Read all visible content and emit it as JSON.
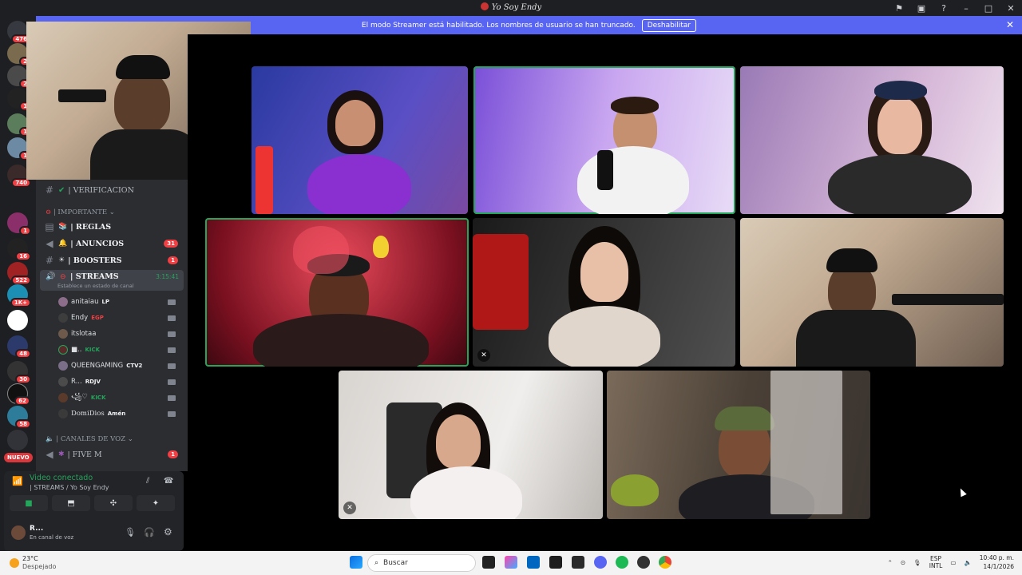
{
  "window": {
    "title": "Yo Soy Endy",
    "controls": [
      "minimize",
      "maximize",
      "close"
    ]
  },
  "streamer_banner": {
    "message": "El modo Streamer está habilitado. Los nombres de usuario se han truncado.",
    "button": "Deshabilitar"
  },
  "servers": {
    "top_badge": "476",
    "badges": [
      "2",
      "2",
      "1",
      "1",
      "1",
      "740",
      "1",
      "16",
      "522",
      "1K+",
      "48",
      "30",
      "62",
      "58"
    ],
    "nuevo": "NUEVO"
  },
  "channels": {
    "verificacion": "| VERIFICACION",
    "cat_importante": "| IMPORTANTE",
    "reglas": "| REGLAS",
    "anuncios": "| ANUNCIOS",
    "anuncios_badge": "31",
    "boosters": "| BOOSTERS",
    "boosters_badge": "1",
    "streams": "| STREAMS",
    "streams_timer": "3:15:41",
    "streams_status": "Establece un estado de canal",
    "members": [
      {
        "name": "anitaiau",
        "tag": "LP"
      },
      {
        "name": "Endy",
        "tag": "EGP"
      },
      {
        "name": "itslotaa",
        "tag": ""
      },
      {
        "name": "■..",
        "tag": "KICK"
      },
      {
        "name": "QUEENGAMING",
        "tag": "CTV2"
      },
      {
        "name": "R...",
        "tag": "RDJV"
      },
      {
        "name": "꧁♡",
        "tag": "KICK"
      },
      {
        "name": "DomiDios",
        "tag": "Amén"
      }
    ],
    "cat_voz": "| CANALES DE VOZ",
    "fivem": "| FIVE M",
    "fivem_badge": "1"
  },
  "voice": {
    "title": "Video conectado",
    "channel": "| STREAMS / Yo Soy Endy",
    "user_name": "R...",
    "user_status": "En canal de voz"
  },
  "taskbar": {
    "temp": "23°C",
    "weather": "Despejado",
    "search_placeholder": "Buscar",
    "lang1": "ESP",
    "lang2": "INTL",
    "time": "10:40 p. m.",
    "date": "14/1/2026"
  },
  "colors": {
    "accent": "#5865f2",
    "speaking": "#23a55a",
    "badge": "#f23f43"
  }
}
